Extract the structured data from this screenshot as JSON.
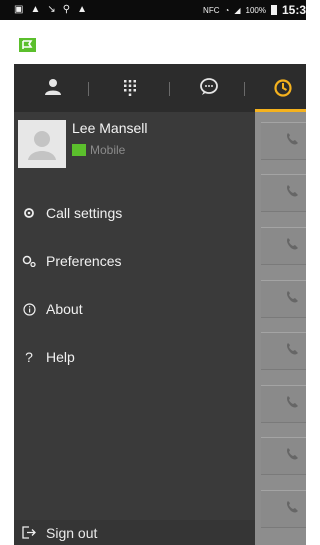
{
  "status_bar": {
    "battery": "100%",
    "time": "15:3"
  },
  "tabs": [
    {
      "name": "contacts-icon"
    },
    {
      "name": "dialpad-icon"
    },
    {
      "name": "chat-icon"
    },
    {
      "name": "call-history-icon",
      "active": true
    }
  ],
  "profile": {
    "name": "Lee Mansell",
    "status": "Mobile",
    "status_color": "#5bbf2c"
  },
  "menu": [
    {
      "label": "Call settings",
      "icon": "gear-icon"
    },
    {
      "label": "Preferences",
      "icon": "preferences-icon"
    },
    {
      "label": "About",
      "icon": "info-icon"
    },
    {
      "label": "Help",
      "icon": "help-icon"
    }
  ],
  "signout": {
    "label": "Sign out",
    "icon": "sign-out-icon"
  },
  "colors": {
    "accent": "#f5b21e",
    "drawer_bg": "#3a3a3a",
    "tabbar_bg": "#2c2c2c"
  }
}
